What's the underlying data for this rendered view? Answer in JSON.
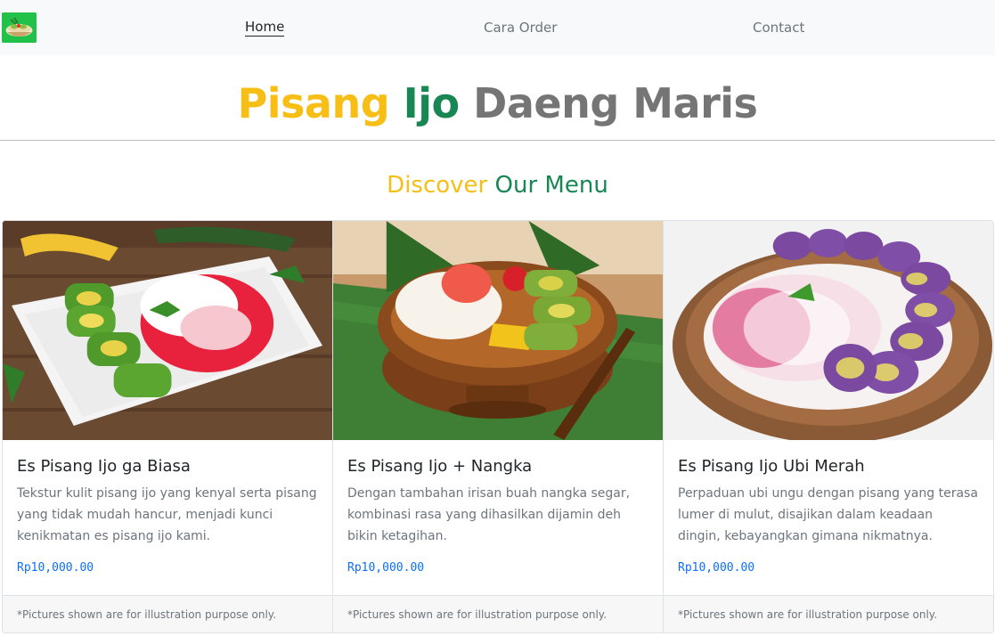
{
  "navbar": {
    "logo_icon": "bowl-dessert-icon",
    "items": [
      {
        "label": "Home",
        "active": true
      },
      {
        "label": "Cara Order",
        "active": false
      },
      {
        "label": "Contact",
        "active": false
      }
    ]
  },
  "header": {
    "title_part1": "Pisang",
    "title_part2": "Ijo",
    "title_part3": "Daeng Maris",
    "colors": {
      "yellow": "#f7be16",
      "green": "#198754",
      "gray": "#757575"
    }
  },
  "menu_section": {
    "title_part1": "Discover",
    "title_part2": "Our Menu"
  },
  "cards": [
    {
      "title": "Es Pisang Ijo ga Biasa",
      "description": "Tekstur kulit pisang ijo yang kenyal serta pisang yang tidak mudah hancur, menjadi kunci kenikmatan es pisang ijo kami.",
      "price": "Rp10,000.00",
      "footer": "*Pictures shown are for illustration purpose only.",
      "image": "es-pisang-ijo-plate-photo"
    },
    {
      "title": "Es Pisang Ijo + Nangka",
      "description": "Dengan tambahan irisan buah nangka segar, kombinasi rasa yang dihasilkan dijamin deh bikin ketagihan.",
      "price": "Rp10,000.00",
      "footer": "*Pictures shown are for illustration purpose only.",
      "image": "es-pisang-ijo-nangka-bowl-photo"
    },
    {
      "title": "Es Pisang Ijo Ubi Merah",
      "description": "Perpaduan ubi ungu dengan pisang yang terasa lumer di mulut, disajikan dalam keadaan dingin, kebayangkan gimana nikmatnya.",
      "price": "Rp10,000.00",
      "footer": "*Pictures shown are for illustration purpose only.",
      "image": "es-pisang-ijo-ubi-bowl-photo"
    }
  ]
}
